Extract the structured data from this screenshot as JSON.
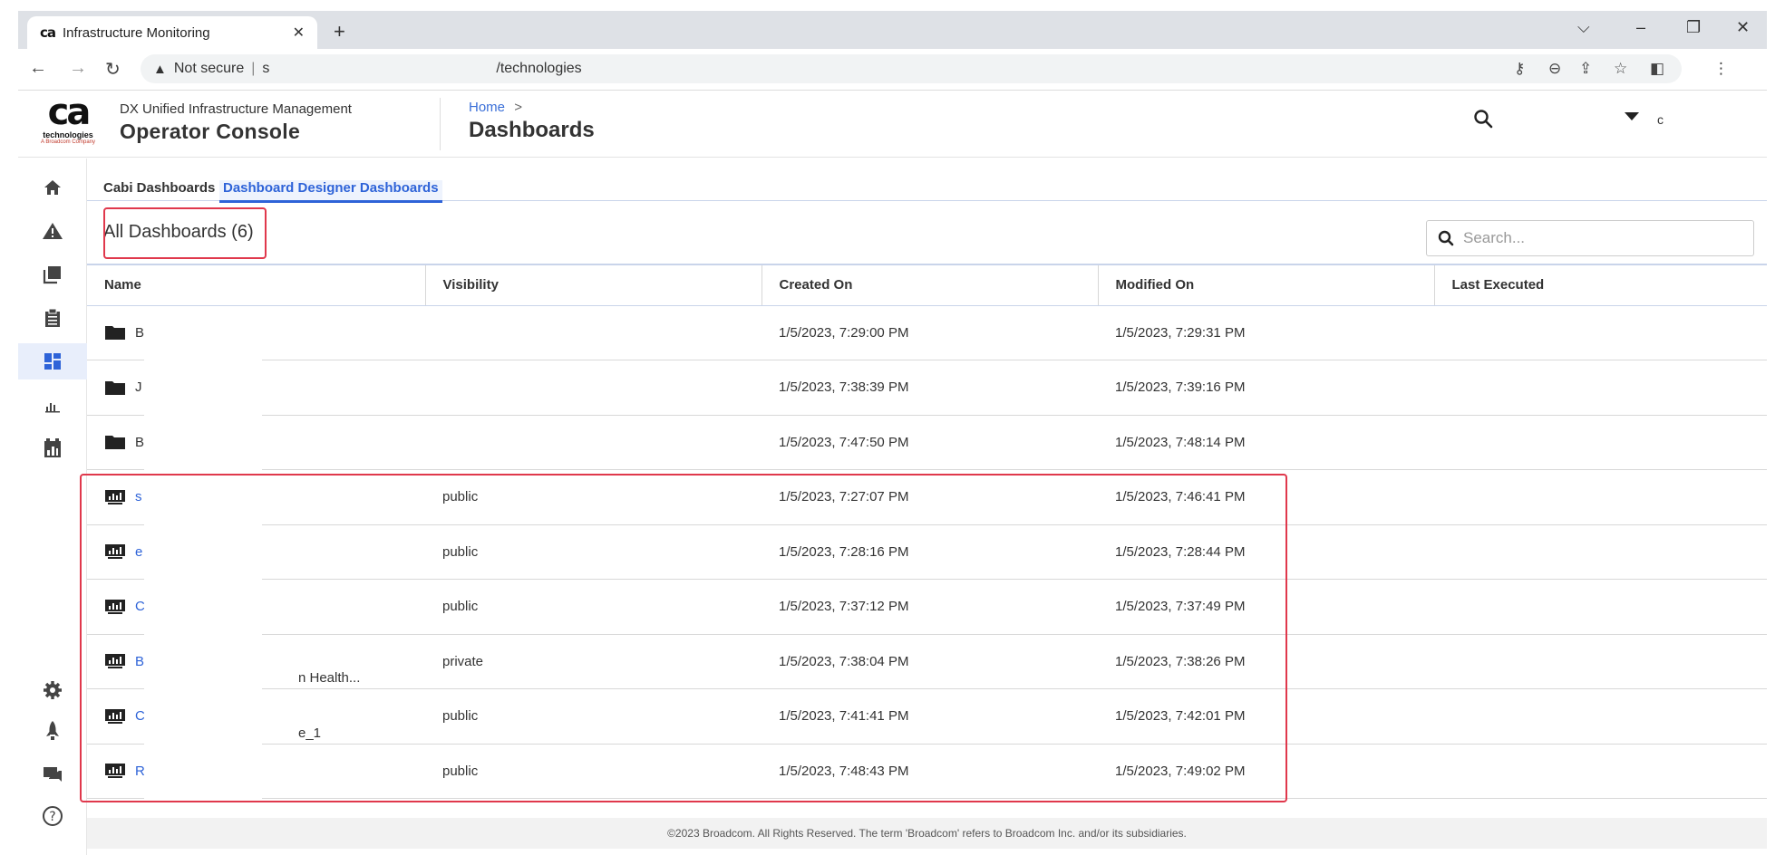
{
  "browser": {
    "tab_title": "Infrastructure Monitoring",
    "tab_favicon": "ca",
    "security_label": "Not secure",
    "url_host": "s",
    "url_path": "/technologies"
  },
  "header": {
    "logo_mark": "ca",
    "logo_tech": "technologies",
    "logo_company": "A Broadcom Company",
    "product_subtitle": "DX Unified Infrastructure Management",
    "product_title": "Operator Console",
    "breadcrumb_home": "Home",
    "breadcrumb_sep": ">",
    "page_title": "Dashboards",
    "user_name": "c"
  },
  "rail": {
    "items": [
      "home-icon",
      "alarm-icon",
      "inventory-icon",
      "reports-icon",
      "dashboards-icon",
      "metrics-icon",
      "slm-icon"
    ],
    "bottom_items": [
      "settings-icon",
      "launch-icon",
      "chat-icon",
      "help-icon"
    ]
  },
  "subtabs": [
    "Cabi Dashboards",
    "Dashboard Designer Dashboards"
  ],
  "list_title": "All Dashboards (6)",
  "search": {
    "placeholder": "Search..."
  },
  "table": {
    "columns": [
      "Name",
      "Visibility",
      "Created On",
      "Modified On",
      "Last Executed"
    ],
    "rows": [
      {
        "type": "folder",
        "name": "B",
        "visibility": "",
        "created": "1/5/2023, 7:29:00 PM",
        "modified": "1/5/2023, 7:29:31 PM",
        "last_executed": ""
      },
      {
        "type": "folder",
        "name": "J",
        "visibility": "",
        "created": "1/5/2023, 7:38:39 PM",
        "modified": "1/5/2023, 7:39:16 PM",
        "last_executed": ""
      },
      {
        "type": "folder",
        "name": "B",
        "visibility": "",
        "created": "1/5/2023, 7:47:50 PM",
        "modified": "1/5/2023, 7:48:14 PM",
        "last_executed": ""
      },
      {
        "type": "dashboard",
        "name": "s",
        "visibility": "public",
        "created": "1/5/2023, 7:27:07 PM",
        "modified": "1/5/2023, 7:46:41 PM",
        "last_executed": ""
      },
      {
        "type": "dashboard",
        "name": "e",
        "visibility": "public",
        "created": "1/5/2023, 7:28:16 PM",
        "modified": "1/5/2023, 7:28:44 PM",
        "last_executed": ""
      },
      {
        "type": "dashboard",
        "name": "C",
        "visibility": "public",
        "created": "1/5/2023, 7:37:12 PM",
        "modified": "1/5/2023, 7:37:49 PM",
        "last_executed": ""
      },
      {
        "type": "dashboard",
        "name": "B",
        "name_tail": "n Health...",
        "visibility": "private",
        "created": "1/5/2023, 7:38:04 PM",
        "modified": "1/5/2023, 7:38:26 PM",
        "last_executed": ""
      },
      {
        "type": "dashboard",
        "name": "C",
        "name_tail": "e_1",
        "visibility": "public",
        "created": "1/5/2023, 7:41:41 PM",
        "modified": "1/5/2023, 7:42:01 PM",
        "last_executed": ""
      },
      {
        "type": "dashboard",
        "name": "R",
        "visibility": "public",
        "created": "1/5/2023, 7:48:43 PM",
        "modified": "1/5/2023, 7:49:02 PM",
        "last_executed": ""
      }
    ]
  },
  "footer": "©2023 Broadcom. All Rights Reserved. The term 'Broadcom' refers to Broadcom Inc. and/or its subsidiaries.",
  "colors": {
    "accent": "#2e63d8",
    "highlight": "#e0384c"
  }
}
